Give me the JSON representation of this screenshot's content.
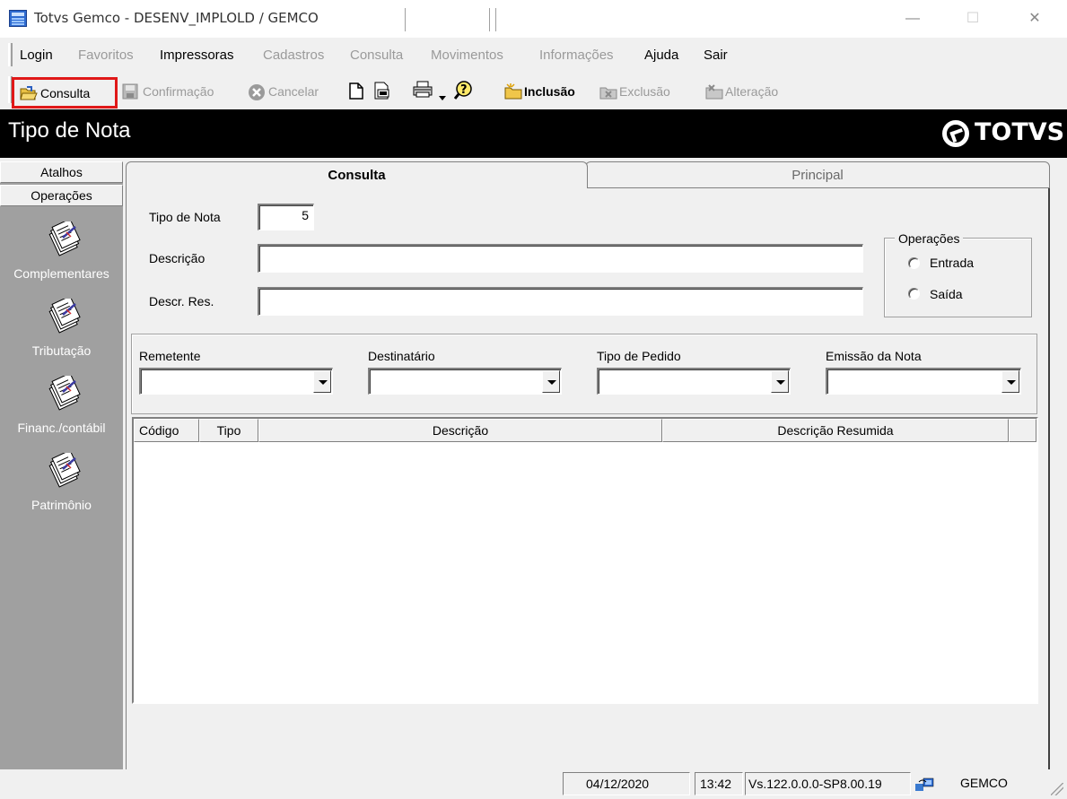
{
  "window": {
    "title": "Totvs Gemco - DESENV_IMPLOLD / GEMCO",
    "minimize_label": "—",
    "maximize_label": "☐",
    "close_label": "✕"
  },
  "menu": {
    "items": [
      {
        "label": "Login",
        "enabled": true
      },
      {
        "label": "Favoritos",
        "enabled": false
      },
      {
        "label": "Impressoras",
        "enabled": true
      },
      {
        "label": "Cadastros",
        "enabled": false
      },
      {
        "label": "Consulta",
        "enabled": false
      },
      {
        "label": "Movimentos",
        "enabled": false
      },
      {
        "label": "Informações",
        "enabled": false
      },
      {
        "label": "Ajuda",
        "enabled": true
      },
      {
        "label": "Sair",
        "enabled": true
      }
    ]
  },
  "toolbar": {
    "consulta": "Consulta",
    "confirmacao": "Confirmação",
    "cancelar": "Cancelar",
    "inclusao": "Inclusão",
    "exclusao": "Exclusão",
    "alteracao": "Alteração"
  },
  "header": {
    "title": "Tipo de Nota",
    "logo": "TOTVS"
  },
  "sidebar": {
    "tab_atalhos": "Atalhos",
    "tab_operacoes": "Operações",
    "items": [
      {
        "label": "Complementares"
      },
      {
        "label": "Tributação"
      },
      {
        "label": "Financ./contábil"
      },
      {
        "label": "Patrimônio"
      }
    ]
  },
  "tabs": {
    "consulta": "Consulta",
    "principal": "Principal"
  },
  "form": {
    "tipo_label": "Tipo de Nota",
    "tipo_value": "5",
    "descricao_label": "Descrição",
    "descricao_value": "",
    "descr_res_label": "Descr. Res.",
    "descr_res_value": "",
    "operacoes_legend": "Operações",
    "radio_entrada": "Entrada",
    "radio_saida": "Saída"
  },
  "filters": {
    "remetente": "Remetente",
    "destinatario": "Destinatário",
    "tipo_pedido": "Tipo de Pedido",
    "emissao": "Emissão da Nota"
  },
  "grid": {
    "columns": [
      "Código",
      "Tipo",
      "Descrição",
      "Descrição Resumida"
    ]
  },
  "status": {
    "date": "04/12/2020",
    "time": "13:42",
    "version": "Vs.122.0.0.0-SP8.00.19",
    "db": "GEMCO"
  }
}
